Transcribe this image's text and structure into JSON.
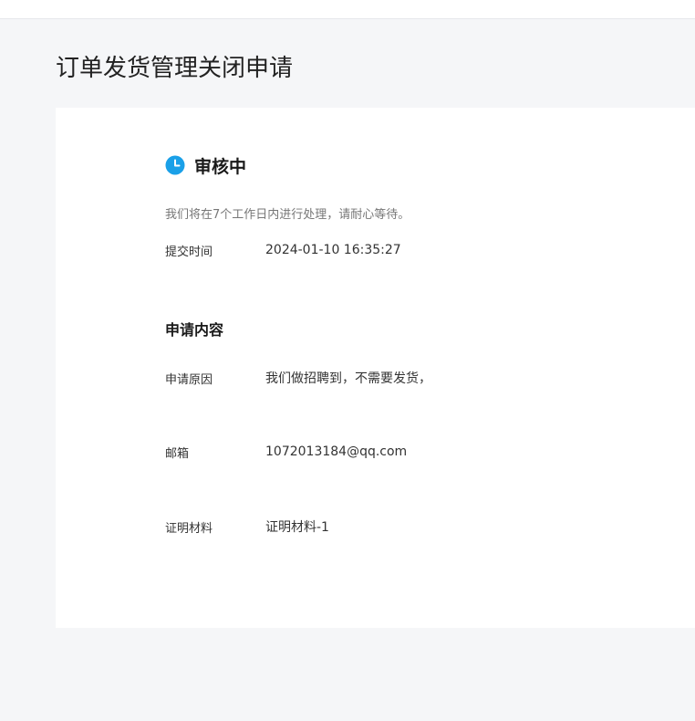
{
  "page": {
    "title": "订单发货管理关闭申请"
  },
  "status": {
    "icon": "clock-icon",
    "text": "审核中",
    "description": "我们将在7个工作日内进行处理，请耐心等待。",
    "icon_color": "#1aa0e8"
  },
  "submit": {
    "label": "提交时间",
    "value": "2024-01-10 16:35:27"
  },
  "application": {
    "section_title": "申请内容",
    "fields": [
      {
        "label": "申请原因",
        "value": "我们做招聘到，不需要发货，"
      },
      {
        "label": "邮箱",
        "value": "1072013184@qq.com"
      },
      {
        "label": "证明材料",
        "value": "证明材料-1"
      }
    ]
  }
}
